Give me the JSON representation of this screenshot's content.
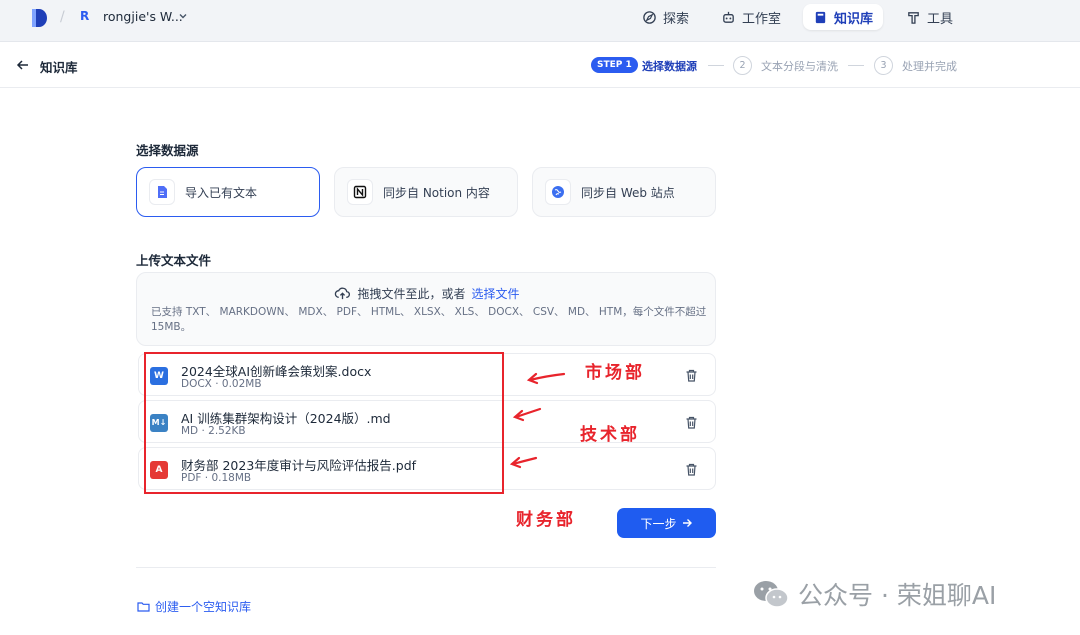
{
  "topnav": {
    "workspace_avatar": "R",
    "workspace_name": "rongjie's W...",
    "items": [
      {
        "label": "探索",
        "icon": "compass-icon"
      },
      {
        "label": "工作室",
        "icon": "robot-icon"
      },
      {
        "label": "知识库",
        "icon": "book-icon",
        "active": true
      },
      {
        "label": "工具",
        "icon": "tool-icon"
      }
    ]
  },
  "subbar": {
    "title": "知识库",
    "steps": [
      {
        "badge": "STEP 1",
        "label": "选择数据源",
        "active": true
      },
      {
        "num": "2",
        "label": "文本分段与清洗"
      },
      {
        "num": "3",
        "label": "处理并完成"
      }
    ]
  },
  "datasource": {
    "title": "选择数据源",
    "options": [
      {
        "label": "导入已有文本",
        "icon": "file-text-icon",
        "selected": true
      },
      {
        "label": "同步自 Notion 内容",
        "icon": "notion-icon"
      },
      {
        "label": "同步自 Web 站点",
        "icon": "globe-icon"
      }
    ]
  },
  "upload": {
    "title": "上传文本文件",
    "drag_text": "拖拽文件至此，或者",
    "link_text": "选择文件",
    "hint": "已支持 TXT、 MARKDOWN、 MDX、 PDF、 HTML、 XLSX、 XLS、 DOCX、 CSV、 MD、 HTM，每个文件不超过 15MB。"
  },
  "files": [
    {
      "name": "2024全球AI创新峰会策划案.docx",
      "meta": "DOCX · 0.02MB",
      "icon_text": "W",
      "icon_color": "#2b6fe0"
    },
    {
      "name": "AI 训练集群架构设计（2024版）.md",
      "meta": "MD · 2.52KB",
      "icon_text": "M↓",
      "icon_color": "#3b82c4"
    },
    {
      "name": "财务部 2023年度审计与风险评估报告.pdf",
      "meta": "PDF · 0.18MB",
      "icon_text": "A",
      "icon_color": "#e53935"
    }
  ],
  "annotations": [
    "市场部",
    "技术部",
    "财务部"
  ],
  "next_button": "下一步",
  "create_empty": "创建一个空知识库",
  "watermark": "公众号 · 荣姐聊AI",
  "colors": {
    "accent": "#2b5cf0",
    "annotation": "#e8242c"
  }
}
